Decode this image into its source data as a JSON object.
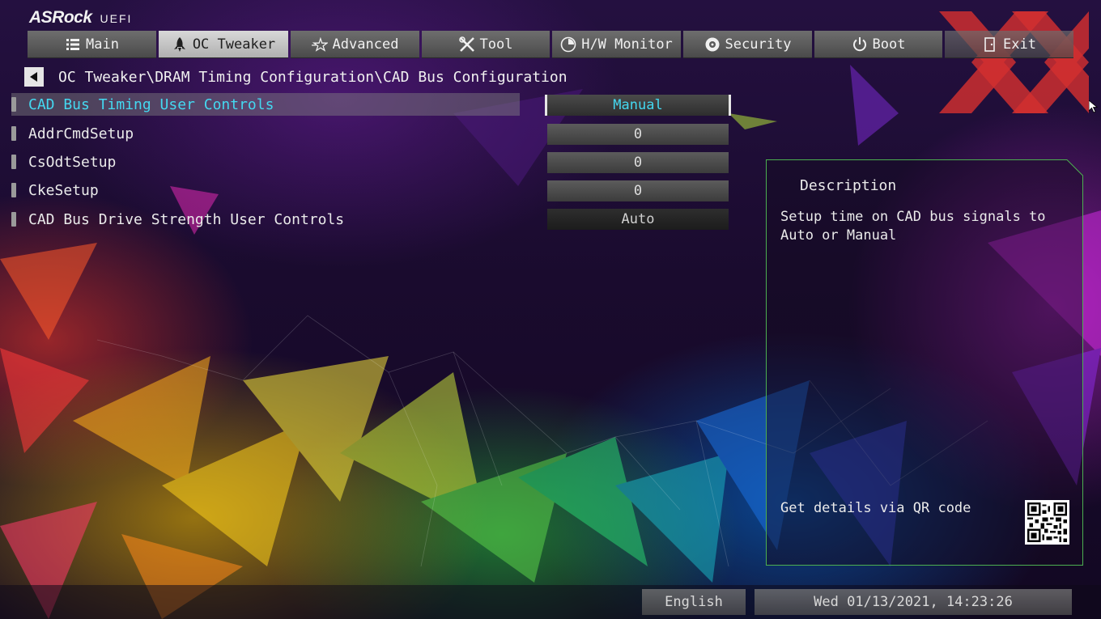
{
  "logo": {
    "brand": "ASRock",
    "sub": "UEFI"
  },
  "tabs": [
    {
      "label": "Main",
      "icon": "list-icon",
      "active": false
    },
    {
      "label": "OC Tweaker",
      "icon": "rocket-icon",
      "active": true
    },
    {
      "label": "Advanced",
      "icon": "star-icon",
      "active": false
    },
    {
      "label": "Tool",
      "icon": "tools-icon",
      "active": false
    },
    {
      "label": "H/W Monitor",
      "icon": "monitor-icon",
      "active": false
    },
    {
      "label": "Security",
      "icon": "shield-icon",
      "active": false
    },
    {
      "label": "Boot",
      "icon": "power-icon",
      "active": false
    },
    {
      "label": "Exit",
      "icon": "exit-icon",
      "active": false
    }
  ],
  "breadcrumb": {
    "path": "OC Tweaker\\DRAM Timing Configuration\\CAD Bus Configuration"
  },
  "settings": [
    {
      "label": "CAD Bus Timing User Controls",
      "value": "Manual",
      "selected": true
    },
    {
      "label": "AddrCmdSetup",
      "value": "0",
      "selected": false
    },
    {
      "label": "CsOdtSetup",
      "value": "0",
      "selected": false
    },
    {
      "label": "CkeSetup",
      "value": "0",
      "selected": false
    },
    {
      "label": "CAD Bus Drive Strength User Controls",
      "value": "Auto",
      "selected": false
    }
  ],
  "description": {
    "title": "Description",
    "body": "Setup time on CAD bus signals to Auto or Manual",
    "qr_text": "Get details via QR code"
  },
  "footer": {
    "language": "English",
    "datetime": "Wed 01/13/2021, 14:23:26"
  },
  "colors": {
    "highlight": "#44d8f0",
    "panel_border": "#4caf50",
    "watermark": "#d32f2f"
  }
}
